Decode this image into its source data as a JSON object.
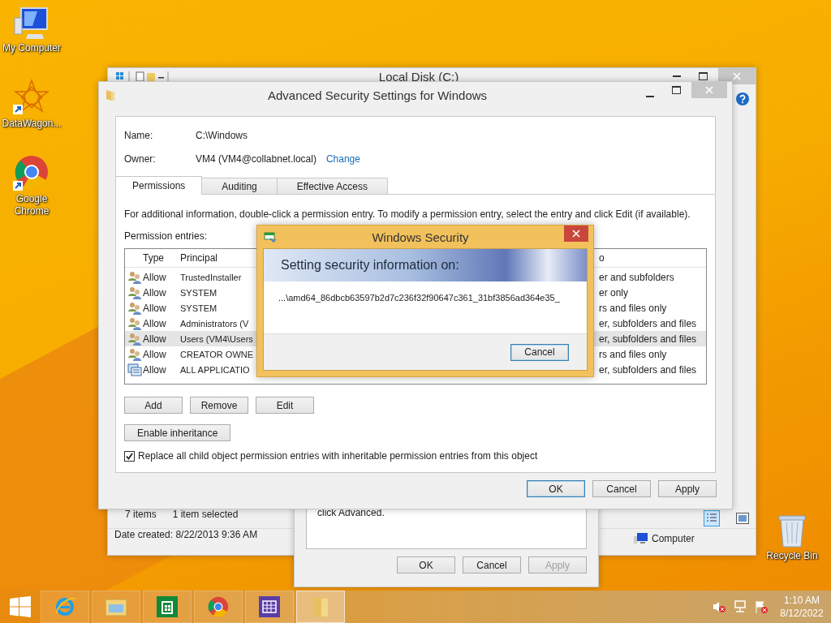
{
  "desktop_icons": [
    {
      "label": "My Computer",
      "kind": "computer"
    },
    {
      "label": "DataWagon...",
      "kind": "app"
    },
    {
      "label": "Google Chrome",
      "kind": "browser"
    }
  ],
  "recycle_bin": {
    "label": "Recycle Bin"
  },
  "explorer": {
    "title": "Local Disk (C:)",
    "status": {
      "item_count": "7 items",
      "selection": "1 item selected",
      "date_created": "Date created: 8/22/2013 9:36 AM",
      "location": "Computer"
    }
  },
  "properties_dialog": {
    "text": "click Advanced.",
    "buttons": [
      {
        "label": "OK",
        "disabled": false
      },
      {
        "label": "Cancel",
        "disabled": false
      },
      {
        "label": "Apply",
        "disabled": true
      }
    ]
  },
  "advanced_security": {
    "title": "Advanced Security Settings for Windows",
    "name_label": "Name:",
    "name_value": "C:\\Windows",
    "owner_label": "Owner:",
    "owner_value": "VM4 (VM4@collabnet.local)",
    "change_link": "Change",
    "tabs": [
      {
        "label": "Permissions",
        "selected": true
      },
      {
        "label": "Auditing",
        "selected": false
      },
      {
        "label": "Effective Access",
        "selected": false
      }
    ],
    "info": "For additional information, double-click a permission entry. To modify a permission entry, select the entry and click Edit (if available).",
    "entries_label": "Permission entries:",
    "columns": [
      "Type",
      "Principal",
      "o"
    ],
    "entries": [
      {
        "kind": "user",
        "type": "Allow",
        "principal": "TrustedInstaller",
        "applies_to": "er and subfolders",
        "selected": false
      },
      {
        "kind": "user",
        "type": "Allow",
        "principal": "SYSTEM",
        "applies_to": "er only",
        "selected": false
      },
      {
        "kind": "user",
        "type": "Allow",
        "principal": "SYSTEM",
        "applies_to": "rs and files only",
        "selected": false
      },
      {
        "kind": "user",
        "type": "Allow",
        "principal": "Administrators (V",
        "applies_to": "er, subfolders and files",
        "selected": false
      },
      {
        "kind": "user",
        "type": "Allow",
        "principal": "Users (VM4\\Users",
        "applies_to": "er, subfolders and files",
        "selected": true
      },
      {
        "kind": "user",
        "type": "Allow",
        "principal": "CREATOR OWNE",
        "applies_to": "rs and files only",
        "selected": false
      },
      {
        "kind": "package",
        "type": "Allow",
        "principal": "ALL APPLICATIO",
        "applies_to": "er, subfolders and files",
        "selected": false
      }
    ],
    "entry_buttons": [
      "Add",
      "Remove",
      "Edit"
    ],
    "inheritance_button": "Enable inheritance",
    "replace_checkbox": {
      "label": "Replace all child object permission entries with inheritable permission entries from this object",
      "checked": true
    },
    "footer_buttons": [
      {
        "label": "OK",
        "default": true
      },
      {
        "label": "Cancel",
        "default": false
      },
      {
        "label": "Apply",
        "default": false
      }
    ]
  },
  "security_dialog": {
    "title": "Windows Security",
    "heading": "Setting security information on:",
    "path": "...\\amd64_86dbcb63597b2d7c236f32f90647c361_31bf3856ad364e35_",
    "button": "Cancel"
  },
  "taskbar": {
    "apps": [
      {
        "kind": "ie",
        "selected": false
      },
      {
        "kind": "explorer",
        "selected": false
      },
      {
        "kind": "store",
        "selected": false
      },
      {
        "kind": "chrome",
        "selected": false
      },
      {
        "kind": "calendar",
        "selected": false
      },
      {
        "kind": "folder",
        "selected": true
      }
    ],
    "clock": {
      "time": "1:10 AM",
      "date": "8/12/2022"
    }
  }
}
